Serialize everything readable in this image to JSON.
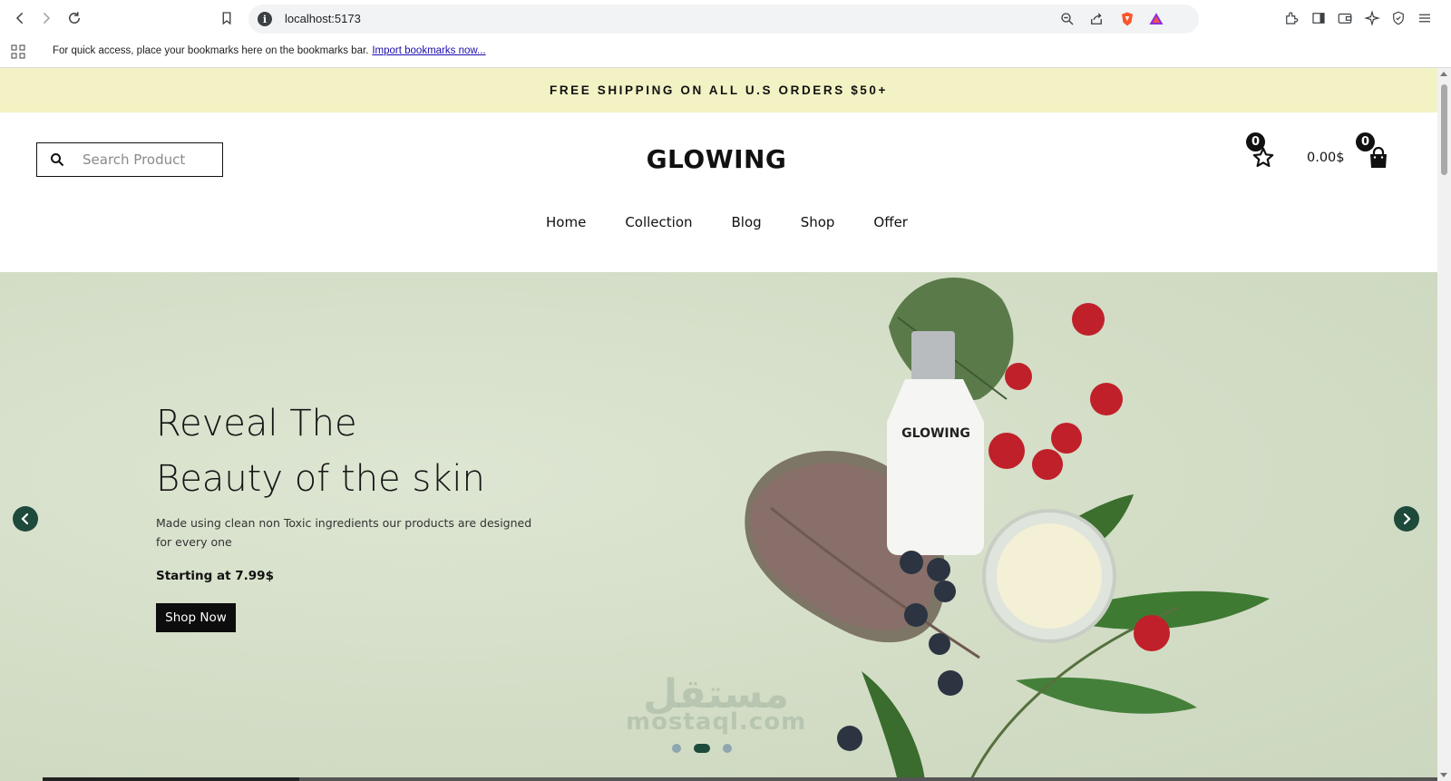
{
  "browser": {
    "url": "localhost:5173",
    "bookmarks_message": "For quick access, place your bookmarks here on the bookmarks bar.",
    "import_link": "Import bookmarks now..."
  },
  "promo": {
    "text": "FREE SHIPPING ON ALL U.S ORDERS $50+"
  },
  "header": {
    "search_placeholder": "Search Product",
    "logo": "GLOWING",
    "wishlist_count": "0",
    "cart_total": "0.00$",
    "cart_count": "0"
  },
  "nav": {
    "items": [
      {
        "label": "Home"
      },
      {
        "label": "Collection"
      },
      {
        "label": "Blog"
      },
      {
        "label": "Shop"
      },
      {
        "label": "Offer"
      }
    ]
  },
  "hero": {
    "title_line1": "Reveal The",
    "title_line2": "Beauty of the skin",
    "description": "Made using clean non Toxic ingredients our products are designed for every one",
    "price_text": "Starting at 7.99$",
    "cta_label": "Shop Now",
    "bottle_label": "GLOWING",
    "slide_count": 3,
    "active_slide": 2,
    "watermark_ar": "مستقل",
    "watermark_en": "mostaql.com"
  },
  "colors": {
    "promo_bg": "#f3f2c5",
    "hero_bg": "#d5dfc8",
    "accent": "#1e4a3b",
    "button_bg": "#0d0d0d"
  }
}
